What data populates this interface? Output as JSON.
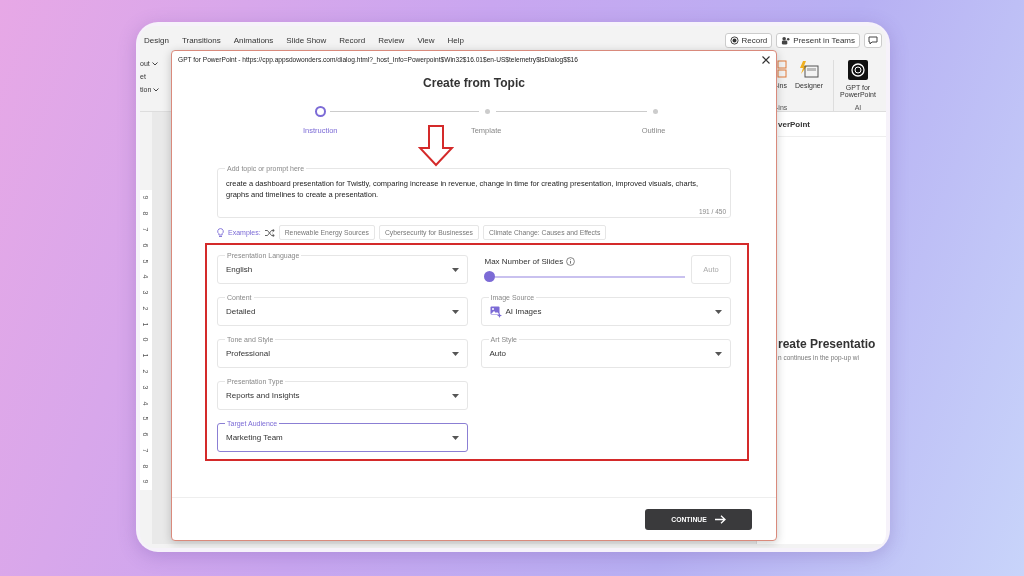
{
  "ribbon": {
    "tabs": [
      "Design",
      "Transitions",
      "Animations",
      "Slide Show",
      "Record",
      "Review",
      "View",
      "Help"
    ],
    "record_button": "Record",
    "present_button": "Present in Teams",
    "left_items": [
      {
        "label": "out",
        "dropdown": true
      },
      {
        "label": "et",
        "dropdown": false
      },
      {
        "label": "tion",
        "dropdown": true
      }
    ],
    "groups": [
      {
        "label": "-ins",
        "items": [
          "-ins",
          "Designer"
        ]
      },
      {
        "label": "AI",
        "items": [
          "GPT for PowerPoint"
        ]
      }
    ]
  },
  "ruler": [
    "9",
    "8",
    "7",
    "6",
    "5",
    "4",
    "3",
    "2",
    "1",
    "0",
    "1",
    "2",
    "3",
    "4",
    "5",
    "6",
    "7",
    "8",
    "9"
  ],
  "side_pane": {
    "title": "verPoint",
    "heading": "reate Presentatio",
    "text": "n continues in the pop-up wi"
  },
  "dialog": {
    "title": "GPT for PowerPoint - https://cpp.appsdowonders.com/dialog.html?_host_Info=Powerpoint$Win32$16.01$en-US$telemetry$isDialog$$16",
    "heading": "Create from Topic",
    "steps": [
      {
        "label": "Instruction",
        "selected": true
      },
      {
        "label": "Template",
        "selected": false
      },
      {
        "label": "Outline",
        "selected": false
      }
    ],
    "prompt": {
      "label": "Add topic or prompt here",
      "value": "create a dashboard presentation for Twistly, comparing increase in revenue, change in time for creating presentation, improved visuals, charts, graphs and timelines to create a presentation.",
      "counter": "191 / 450"
    },
    "examples": {
      "label": "Examples:",
      "items": [
        "Renewable Energy Sources",
        "Cybersecurity for Businesses",
        "Climate Change: Causes and Effects"
      ]
    },
    "left_fields": [
      {
        "label": "Presentation Language",
        "value": "English",
        "focused": false
      },
      {
        "label": "Content",
        "value": "Detailed",
        "focused": false
      },
      {
        "label": "Tone and Style",
        "value": "Professional",
        "focused": false
      },
      {
        "label": "Presentation Type",
        "value": "Reports and Insights",
        "focused": false
      },
      {
        "label": "Target Audience",
        "value": "Marketing Team",
        "focused": true
      }
    ],
    "slider": {
      "label": "Max Number of Slides",
      "level": 0,
      "placeholder": "Auto"
    },
    "right_fields": [
      {
        "label": "Image Source",
        "value": "AI Images",
        "has_icon": true,
        "focused": false
      },
      {
        "label": "Art Style",
        "value": "Auto",
        "has_icon": false,
        "focused": false
      }
    ],
    "continue": "CONTINUE"
  }
}
